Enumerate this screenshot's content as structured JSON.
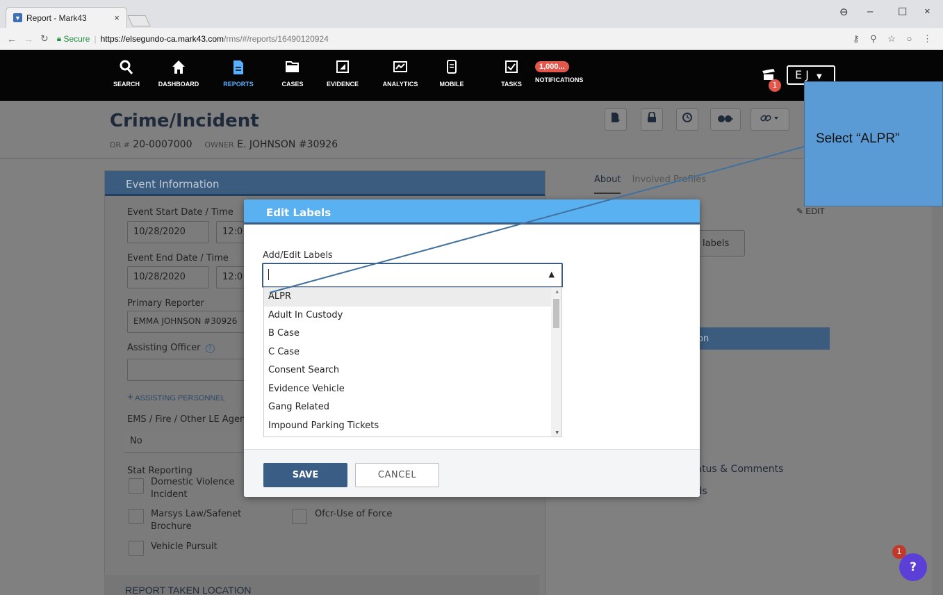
{
  "browser": {
    "tab_title": "Report - Mark43",
    "tab_close": "×",
    "url_secure": "Secure",
    "url_host": "https://elsegundo-ca.mark43.com",
    "url_path": "/rms/#/reports/16490120924",
    "window_controls": {
      "account": "⊖",
      "minimize": "–",
      "maximize": "☐",
      "close": "×"
    }
  },
  "nav": {
    "items": [
      {
        "label": "SEARCH",
        "icon": "search-icon"
      },
      {
        "label": "DASHBOARD",
        "icon": "home-icon"
      },
      {
        "label": "REPORTS",
        "icon": "document-icon"
      },
      {
        "label": "CASES",
        "icon": "folder-icon"
      },
      {
        "label": "EVIDENCE",
        "icon": "evidence-icon"
      },
      {
        "label": "ANALYTICS",
        "icon": "analytics-icon"
      },
      {
        "label": "MOBILE",
        "icon": "mobile-icon"
      },
      {
        "label": "TASKS",
        "icon": "tasks-icon"
      },
      {
        "label": "NOTIFICATIONS",
        "icon": "notifications-icon"
      }
    ],
    "active": "REPORTS",
    "notifications_count": "1,000...",
    "cart_badge": "1",
    "user_initials": "E J"
  },
  "header": {
    "title": "Crime/Incident",
    "dr_label": "DR #",
    "dr_value": "20-0007000",
    "owner_label": "OWNER",
    "owner_value": "E. JOHNSON #30926"
  },
  "event_info": {
    "heading": "Event Information",
    "start_label": "Event Start Date / Time",
    "start_date": "10/28/2020",
    "start_time": "12:0",
    "end_label": "Event End Date / Time",
    "end_date": "10/28/2020",
    "end_time": "12:0",
    "primary_reporter_label": "Primary Reporter",
    "primary_reporter_value": "EMMA JOHNSON #30926",
    "assisting_officer_label": "Assisting Officer",
    "help_icon": "?",
    "assisting_personnel": "ASSISTING PERSONNEL",
    "plus": "+",
    "ems_label": "EMS / Fire / Other LE Agen",
    "ems_value": "No",
    "stat_reporting_label": "Stat Reporting",
    "checkboxes": [
      {
        "label": "Domestic Violence Incident"
      },
      {
        "label": "Marsys Law/Safenet Brochure"
      },
      {
        "label": "Ofcr-Use of Force"
      },
      {
        "label": "Vehicle Pursuit"
      }
    ],
    "report_taken_location": "REPORT TAKEN LOCATION"
  },
  "right_panel": {
    "tab_about": "About",
    "tab_involved": "Involved Profiles",
    "edit": "EDIT",
    "labels_button": "labels",
    "bar_text": "on",
    "text_t": "t",
    "status_comments": "tatus & Comments",
    "rds": "rds"
  },
  "modal": {
    "title": "Edit Labels",
    "field_label": "Add/Edit Labels",
    "options": [
      "ALPR",
      "Adult In Custody",
      "B Case",
      "C Case",
      "Consent Search",
      "Evidence Vehicle",
      "Gang Related",
      "Impound Parking Tickets"
    ],
    "highlighted": "ALPR",
    "save": "SAVE",
    "cancel": "CANCEL"
  },
  "help": {
    "badge": "1",
    "label": "?"
  },
  "callout": {
    "text": "Select “ALPR”"
  },
  "colors": {
    "nav_bg": "#050505",
    "active_nav": "#5ab0ff",
    "modal_header": "#5ab1f2",
    "primary_button": "#3a5d86",
    "callout": "#5b9bd5",
    "badge": "#e2574c",
    "help_button": "#5b3fd6"
  }
}
